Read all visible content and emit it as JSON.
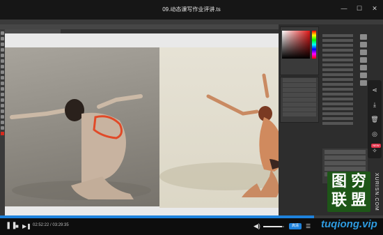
{
  "player": {
    "title": "09.动态课写作业评讲.ts",
    "window_buttons": [
      {
        "name": "minimize",
        "glyph": "—"
      },
      {
        "name": "maximize",
        "glyph": "☐"
      },
      {
        "name": "close",
        "glyph": "✕"
      }
    ]
  },
  "playback": {
    "current_time": "02:52:22",
    "separator": " / ",
    "total_time": "03:29:35",
    "progress_fraction": 0.82,
    "volume_fraction": 0.9,
    "quality_label": "高清"
  },
  "side_toolbar": {
    "icons": [
      "share-icon",
      "download-icon",
      "delete-icon",
      "settings-icon",
      "pin-icon"
    ],
    "badge": "NEW"
  },
  "watermark": {
    "chars": [
      "图",
      "穷",
      "联",
      "盟"
    ],
    "side_text": "XURISN.COM",
    "url": "tuqiong.vip"
  },
  "colors": {
    "accent": "#1e82dc",
    "watermark_bg": "#1e5618",
    "badge": "#e2324a"
  }
}
